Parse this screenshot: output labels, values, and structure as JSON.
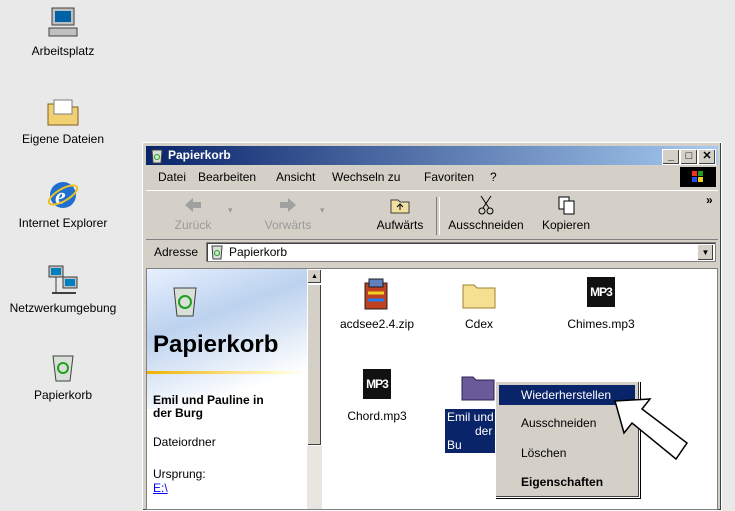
{
  "desktop": {
    "icons": [
      {
        "label": "Arbeitsplatz",
        "icon": "my-computer-icon"
      },
      {
        "label": "Eigene Dateien",
        "icon": "my-documents-icon"
      },
      {
        "label": "Internet Explorer",
        "icon": "internet-explorer-icon"
      },
      {
        "label": "Netzwerkumgebung",
        "icon": "network-icon"
      },
      {
        "label": "Papierkorb",
        "icon": "recycle-bin-icon"
      }
    ]
  },
  "window": {
    "title": "Papierkorb",
    "controls": {
      "minimize": "_",
      "maximize": "□",
      "close": "✕"
    },
    "menu": [
      "Datei",
      "Bearbeiten",
      "Ansicht",
      "Wechseln zu",
      "Favoriten",
      "?"
    ],
    "toolbar": {
      "back": "Zurück",
      "forward": "Vorwärts",
      "up": "Aufwärts",
      "cut": "Ausschneiden",
      "copy": "Kopieren",
      "more": "»"
    },
    "address": {
      "label": "Adresse",
      "value": "Papierkorb"
    },
    "left_panel": {
      "title": "Papierkorb",
      "item_name": "Emil und Pauline in der Burg",
      "item_type": "Dateiordner",
      "origin_label": "Ursprung:",
      "origin_value": "E:\\"
    },
    "files": [
      {
        "name": "acdsee2.4.zip",
        "icon": "zip-archive-icon"
      },
      {
        "name": "Cdex",
        "icon": "folder-icon"
      },
      {
        "name": "Chimes.mp3",
        "icon": "mp3-icon"
      },
      {
        "name": "Chord.mp3",
        "icon": "mp3-icon"
      },
      {
        "name": "Emil und Pauline in der Burg",
        "display_line1": "Emil und P",
        "display_line2": "der Bu",
        "icon": "folder-icon",
        "selected": true
      }
    ]
  },
  "context_menu": {
    "items": [
      "Wiederherstellen",
      "Ausschneiden",
      "Löschen",
      "Eigenschaften"
    ],
    "highlighted": "Wiederherstellen",
    "default": "Eigenschaften"
  },
  "colors": {
    "selection": "#0a246a",
    "face": "#d4d0c8",
    "desktop": "#e9e9e9"
  }
}
